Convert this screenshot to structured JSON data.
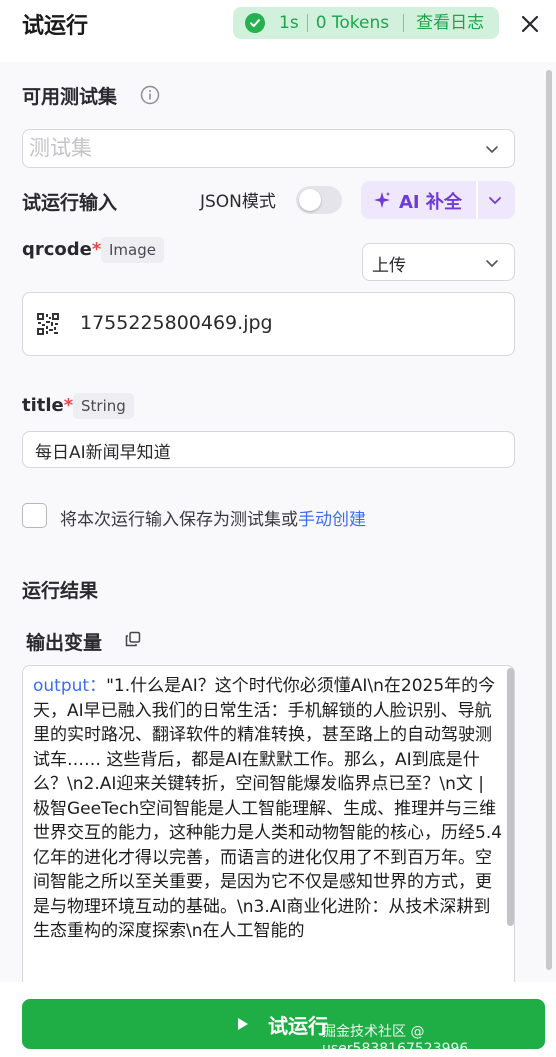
{
  "header": {
    "title": "试运行",
    "status": {
      "time": "1s",
      "tokens": "0 Tokens",
      "logs_label": "查看日志"
    }
  },
  "test_set": {
    "label": "可用测试集",
    "placeholder": "测试集"
  },
  "run_input": {
    "label": "试运行输入",
    "json_mode_label": "JSON模式",
    "json_mode_on": false,
    "ai_fill_label": "AI 补全"
  },
  "fields": [
    {
      "name": "qrcode",
      "required": "*",
      "type": "Image",
      "source_select": "上传",
      "file_name": "1755225800469.jpg"
    },
    {
      "name": "title",
      "required": "*",
      "type": "String",
      "value": "每日AI新闻早知道"
    }
  ],
  "save_option": {
    "text": "将本次运行输入保存为测试集或",
    "link": "手动创建"
  },
  "result": {
    "label": "运行结果",
    "output_vars_label": "输出变量",
    "output_key": "output",
    "output_sep": "：",
    "output_value": "\"1.什么是AI？这个时代你必须懂AI\\n在2025年的今天，AI早已融入我们的日常生活：手机解锁的人脸识别、导航里的实时路况、翻译软件的精准转换，甚至路上的自动驾驶测试车…… 这些背后，都是AI在默默工作。那么，AI到底是什么？\\n2.AI迎来关键转折，空间智能爆发临界点已至？\\n文 | 极智GeeTech空间智能是人工智能理解、生成、推理并与三维世界交互的能力，这种能力是人类和动物智能的核心，历经5.4亿年的进化才得以完善，而语言的进化仅用了不到百万年。空间智能之所以至关重要，是因为它不仅是感知世界的方式，更是与物理环境互动的基础。\\n3.AI商业化进阶：从技术深耕到生态重构的深度探索\\n在人工智能的"
  },
  "run_button_label": "试运行",
  "watermark": "掘金技术社区 @ user5838167523996",
  "colors": {
    "accent_green": "#1fae46",
    "accent_purple": "#6d3bd7",
    "link_blue": "#3d6ef2",
    "required_red": "#e5484d"
  }
}
